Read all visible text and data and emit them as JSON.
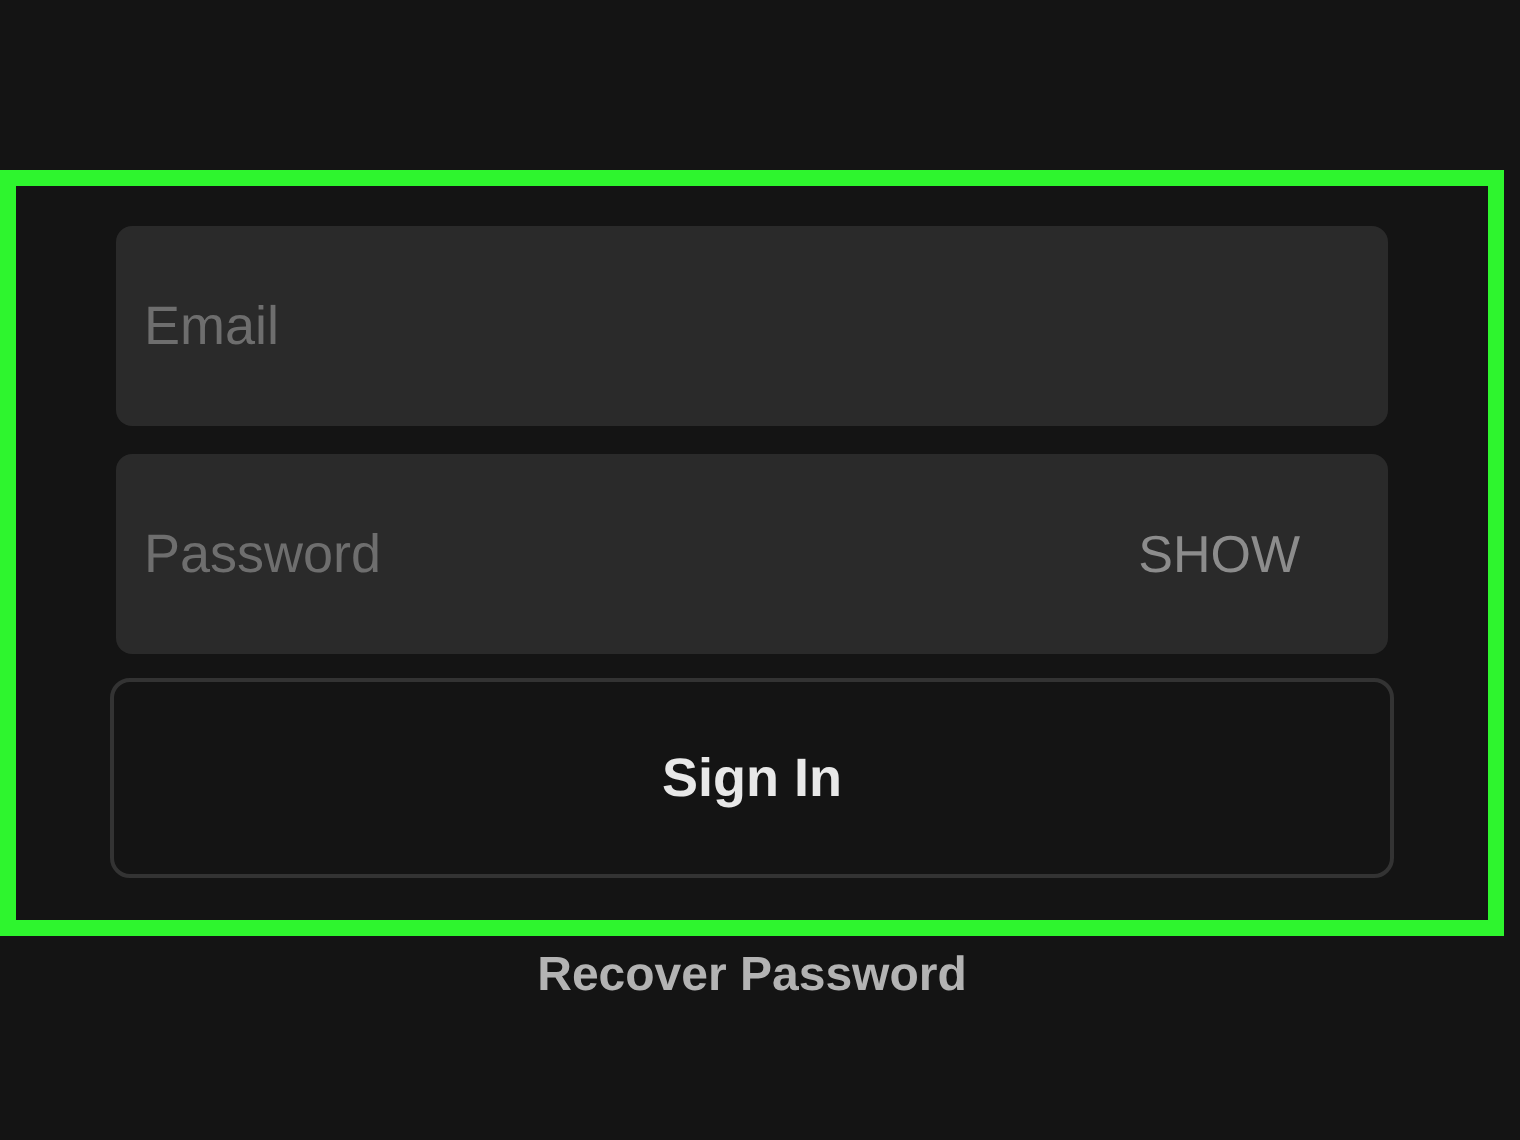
{
  "email": {
    "placeholder": "Email"
  },
  "password": {
    "placeholder": "Password",
    "show_label": "SHOW"
  },
  "sign_in_button": "Sign In",
  "recover_link": "Recover Password"
}
